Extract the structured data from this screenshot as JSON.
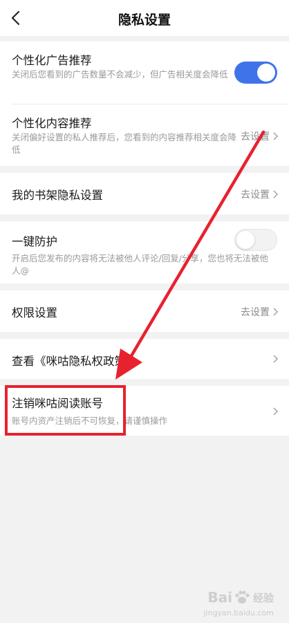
{
  "header": {
    "title": "隐私设置"
  },
  "settings": {
    "ad_recommend": {
      "title": "个性化广告推荐",
      "desc": "关闭后您看到的广告数量不会减少，但广告相关度会降低",
      "enabled": true
    },
    "content_recommend": {
      "title": "个性化内容推荐",
      "desc": "关闭偏好设置的私人推荐后，您看到的内容推荐相关度会降低",
      "action": "去设置"
    },
    "bookshelf_privacy": {
      "title": "我的书架隐私设置",
      "action": "去设置"
    },
    "one_click_protect": {
      "title": "一键防护",
      "desc": "开启后您发布的内容将无法被他人评论/回复/分享，您也将无法被他人@",
      "enabled": false
    },
    "permissions": {
      "title": "权限设置",
      "action": "去设置"
    },
    "privacy_policy": {
      "title": "查看《咪咕隐私权政策》"
    },
    "cancel_account": {
      "title": "注销咪咕阅读账号",
      "desc": "账号内资产注销后不可恢复，请谨慎操作"
    }
  },
  "watermark": {
    "brand_left": "Bai",
    "brand_right": "经验",
    "url": "jingyan.baidu.com"
  },
  "colors": {
    "accent": "#3e74e8",
    "annotation": "#e8212f"
  }
}
